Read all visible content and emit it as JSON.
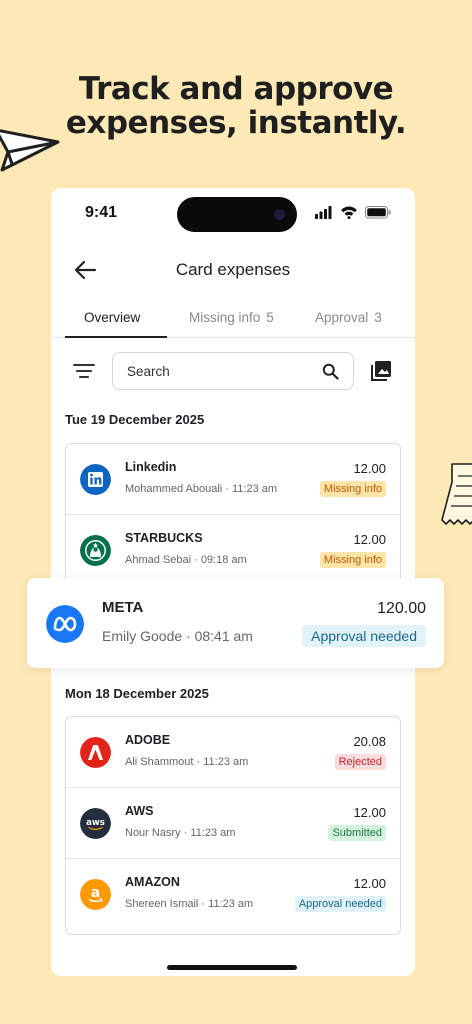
{
  "headline": {
    "line1": "Track and approve",
    "line2": "expenses, instantly."
  },
  "status_bar": {
    "time": "9:41",
    "icons": [
      "signal-icon",
      "wifi-icon",
      "battery-icon"
    ]
  },
  "app_bar": {
    "title": "Card expenses",
    "back_icon": "arrow-left-icon"
  },
  "tabs": [
    {
      "label": "Overview",
      "count": "",
      "active": true
    },
    {
      "label": "Missing info",
      "count": "5",
      "active": false
    },
    {
      "label": "Approval",
      "count": "3",
      "active": false
    }
  ],
  "toolbar": {
    "filter_icon": "filter-icon",
    "search_placeholder": "Search",
    "search_icon": "search-icon",
    "gallery_icon": "gallery-icon"
  },
  "groups": [
    {
      "date": "Tue 19 December 2025",
      "items": [
        {
          "merchant": "Linkedin",
          "meta": "Mohammed Abouali · 11:23 am",
          "amount": "12.00",
          "status": "Missing info",
          "status_color": "#c25a00",
          "logo": "linkedin-logo"
        },
        {
          "merchant": "STARBUCKS",
          "meta": "Ahmad Sebai · 09:18 am",
          "amount": "12.00",
          "status": "Missing info",
          "status_color": "#c25a00",
          "logo": "starbucks-logo"
        }
      ]
    },
    {
      "date": "Mon 18 December 2025",
      "items": [
        {
          "merchant": "ADOBE",
          "meta": "Ali Shammout · 11:23 am",
          "amount": "20.08",
          "status": "Rejected",
          "status_color": "#c0262f",
          "logo": "adobe-logo"
        },
        {
          "merchant": "AWS",
          "meta": "Nour Nasry · 11:23 am",
          "amount": "12.00",
          "status": "Submitted",
          "status_color": "#1e7b3e",
          "logo": "aws-logo"
        },
        {
          "merchant": "AMAZON",
          "meta": "Shereen Ismail · 11:23 am",
          "amount": "12.00",
          "status": "Approval needed",
          "status_color": "#156a8a",
          "logo": "amazon-logo"
        }
      ]
    }
  ],
  "highlighted": {
    "merchant": "META",
    "meta": "Emily Goode · 08:41 am",
    "amount": "120.00",
    "status": "Approval needed",
    "logo": "meta-logo"
  },
  "colors": {
    "background": "#fde9b6",
    "meta_blue": "#1877f2",
    "linkedin_blue": "#0a66c2",
    "starbucks_green": "#00704a",
    "adobe_red": "#e1251b",
    "aws_dark": "#232f3e",
    "amazon_orange": "#ff9900"
  }
}
